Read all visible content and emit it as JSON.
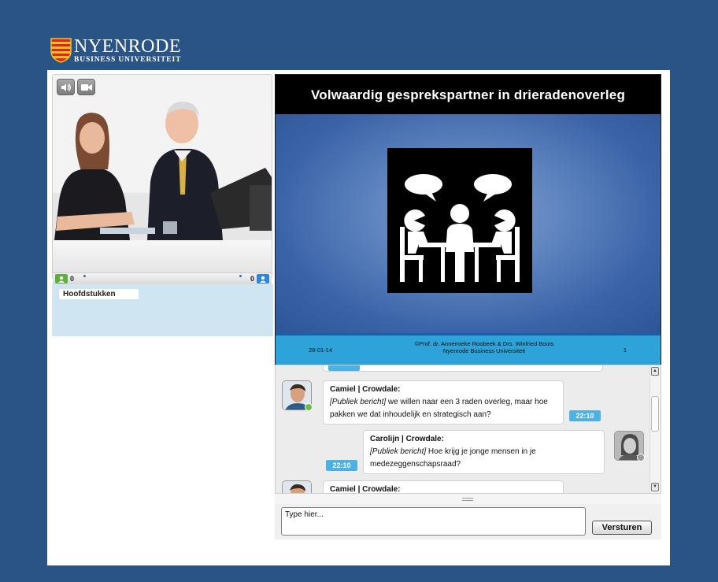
{
  "brand": {
    "title": "NYENRODE",
    "subtitle": "BUSINESS UNIVERSITEIT"
  },
  "video": {
    "controls": [
      {
        "icon": "speaker-icon"
      },
      {
        "icon": "camera-icon"
      }
    ],
    "viewers_left_count": "0",
    "viewers_right_count": "0"
  },
  "chapters": {
    "tab_label": "Hoofdstukken"
  },
  "slide": {
    "title": "Volwaardig gesprekspartner in drieradenoverleg",
    "footer_date": "28-01-14",
    "footer_credit_line1": "©Prof. dr. Annemieke Roobeek & Drs. Winfried Bouts",
    "footer_credit_line2": "Nyenrode Business Universiteit",
    "footer_page": "1"
  },
  "chat": {
    "messages": [
      {
        "author": "Camiel | Crowdale:",
        "tag": "[Publiek bericht]",
        "text": " we willen naar een 3 raden overleg, maar hoe pakken we dat inhoudelijk en strategisch aan?",
        "time": "22:10"
      },
      {
        "author": "Carolijn | Crowdale:",
        "tag": "[Publiek bericht]",
        "text": " Hoe krijg je jonge mensen in je medezeggenschapsraad?",
        "time": "22:10"
      },
      {
        "author": "Camiel | Crowdale:"
      }
    ]
  },
  "composer": {
    "placeholder": "Type hier...",
    "send_label": "Versturen"
  },
  "colors": {
    "background": "#2b5486",
    "accent": "#4db1e6",
    "slide_footer": "#2ea3d9",
    "chapters_bg": "#cfe6f2"
  }
}
